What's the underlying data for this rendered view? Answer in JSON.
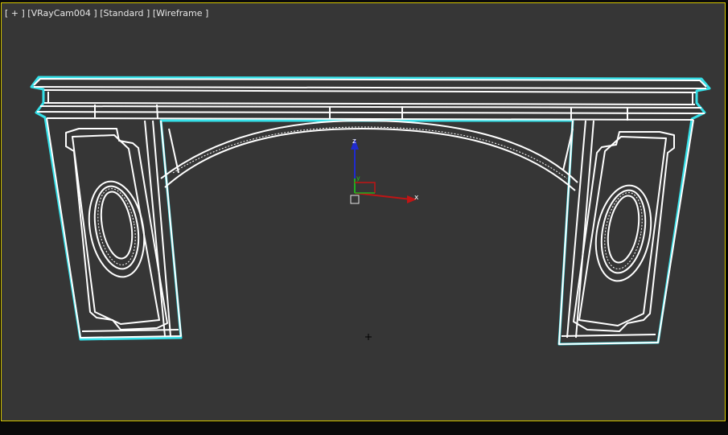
{
  "viewport": {
    "menu_plus": "[ + ]",
    "camera": "[VRayCam004 ]",
    "shading": "[Standard ]",
    "mode": "[Wireframe ]",
    "frame_color": "#d8c800",
    "background": "#363636"
  },
  "gizmo": {
    "axis_x": "x",
    "axis_y": "y",
    "axis_z": "z",
    "icons": [
      "transform-gizmo-icon",
      "pivot-box-icon",
      "crosshair-icon"
    ]
  },
  "scene": {
    "object": "arch-wireframe",
    "wire_color": "#ffffff",
    "outline_color": "#35e0e8"
  }
}
